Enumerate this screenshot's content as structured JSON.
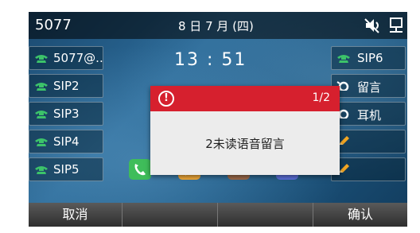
{
  "statusbar": {
    "account": "5077",
    "date": "8 日 7 月 (四)",
    "icons": [
      "mute-icon",
      "network-icon"
    ]
  },
  "clock": "13 : 51",
  "left_keys": [
    {
      "label": "5077@..",
      "icon": "phone-icon"
    },
    {
      "label": "SIP2",
      "icon": "phone-icon"
    },
    {
      "label": "SIP3",
      "icon": "phone-icon"
    },
    {
      "label": "SIP4",
      "icon": "phone-icon"
    },
    {
      "label": "SIP5",
      "icon": "phone-icon"
    }
  ],
  "right_keys": [
    {
      "label": "SIP6",
      "icon": "phone-icon"
    },
    {
      "label": "留言",
      "icon": "voicemail-icon"
    },
    {
      "label": "耳机",
      "icon": "headset-icon"
    },
    {
      "label": "",
      "icon": "pencil-icon"
    },
    {
      "label": "",
      "icon": "pencil-icon"
    }
  ],
  "popup": {
    "count": "1/2",
    "message": "2未读语音留言"
  },
  "softkeys": [
    "取消",
    "",
    "",
    "确认"
  ],
  "colors": {
    "popup_header": "#d6202e",
    "phone_green": "#3cc36a"
  }
}
